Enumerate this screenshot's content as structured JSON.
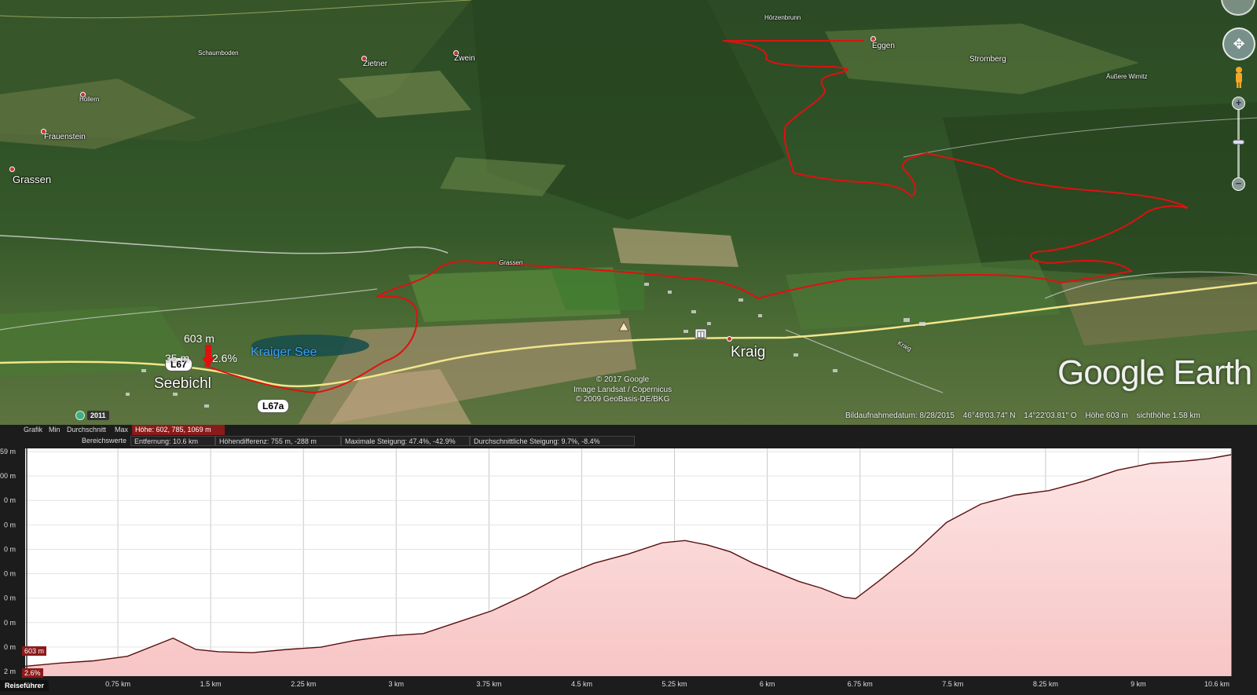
{
  "map": {
    "places": [
      {
        "name": "Höllern",
        "cls": "tiny"
      },
      {
        "name": "Frauenstein",
        "cls": ""
      },
      {
        "name": "Grassen",
        "cls": "big"
      },
      {
        "name": "Schaumboden",
        "cls": "tiny"
      },
      {
        "name": "Zietner",
        "cls": ""
      },
      {
        "name": "Zwein",
        "cls": ""
      },
      {
        "name": "Eggen",
        "cls": ""
      },
      {
        "name": "Stromberg",
        "cls": ""
      },
      {
        "name": "Äußere Wimitz",
        "cls": "tiny"
      },
      {
        "name": "Kraig",
        "cls": "huge"
      },
      {
        "name": "Seebichl",
        "cls": "huge"
      },
      {
        "name": "Grassen",
        "cls": "tiny"
      },
      {
        "name": "Hörzenbrunn",
        "cls": "tiny"
      },
      {
        "name": "Kraig",
        "cls": "tiny"
      }
    ],
    "lake": "Kraiger See",
    "road_shields": [
      "L67",
      "L67a"
    ],
    "marker": {
      "elevation": "603 m",
      "distance": "35 m",
      "grade": "2.6%"
    },
    "copyright_lines": [
      "© 2017 Google",
      "Image Landsat / Copernicus",
      "© 2009 GeoBasis-DE/BKG"
    ],
    "brand": "Google Earth",
    "year": "2011",
    "status": {
      "date": "Bildaufnahmedatum: 8/28/2015",
      "lat": "46°48'03.74\" N",
      "lon": "14°22'03.81\" O",
      "elev": "Höhe   603 m",
      "eye": "sichthöhe   1.58 km"
    },
    "colors": {
      "route": "#e01010",
      "road_main": "#f0e68c"
    }
  },
  "profile": {
    "row1": {
      "grafik": "Grafik",
      "min": "Min",
      "avg": "Durchschnitt",
      "max": "Max",
      "hoehe": "Höhe: 602, 785, 1069 m"
    },
    "row2": {
      "label": "Bereichswerte",
      "entf": "Entfernung: 10.6 km",
      "diff": "Höhendifferenz: 755 m, -288 m",
      "maxslope": "Maximale Steigung: 47.4%, -42.9%",
      "avgslope": "Durchschnittliche Steigung: 9.7%, -8.4%"
    },
    "current_elev_tag": "603 m",
    "current_grade_tag": "2.6%",
    "guide_tab": "Reiseführer",
    "colors": {
      "fill": "#f7c5c5",
      "line": "#5a0f0f",
      "accent": "#8b1a1a"
    }
  },
  "chart_data": {
    "type": "area",
    "xlabel": "",
    "ylabel": "",
    "x_ticks": [
      "0.75 km",
      "1.5 km",
      "2.25 km",
      "3 km",
      "3.75 km",
      "4.5 km",
      "5.25 km",
      "6 km",
      "6.75 km",
      "7.5 km",
      "8.25 km",
      "9 km",
      "10.6 km"
    ],
    "y_tick_labels": [
      "59 m",
      "00 m",
      "0 m",
      "0 m",
      "0 m",
      "0 m",
      "0 m",
      "0 m",
      "0 m",
      "2 m"
    ],
    "xlim": [
      0,
      10.6
    ],
    "ylim": [
      602,
      1069
    ],
    "series": [
      {
        "x": [
          0,
          0.3,
          0.6,
          0.9,
          1.2,
          1.3,
          1.5,
          1.7,
          2.0,
          2.3,
          2.6,
          2.9,
          3.2,
          3.5,
          3.8,
          4.1,
          4.4,
          4.7,
          5.0,
          5.3,
          5.6,
          5.8,
          6.0,
          6.2,
          6.4,
          6.6,
          6.8,
          7.0,
          7.2,
          7.3,
          7.5,
          7.8,
          8.1,
          8.4,
          8.7,
          9.0,
          9.3,
          9.6,
          9.9,
          10.2,
          10.4,
          10.6
        ],
        "y": [
          603,
          610,
          615,
          625,
          655,
          665,
          640,
          635,
          633,
          640,
          645,
          660,
          670,
          675,
          700,
          725,
          760,
          800,
          830,
          850,
          875,
          880,
          870,
          855,
          830,
          810,
          790,
          775,
          755,
          752,
          790,
          850,
          920,
          960,
          980,
          990,
          1010,
          1035,
          1050,
          1055,
          1060,
          1069
        ]
      }
    ]
  }
}
